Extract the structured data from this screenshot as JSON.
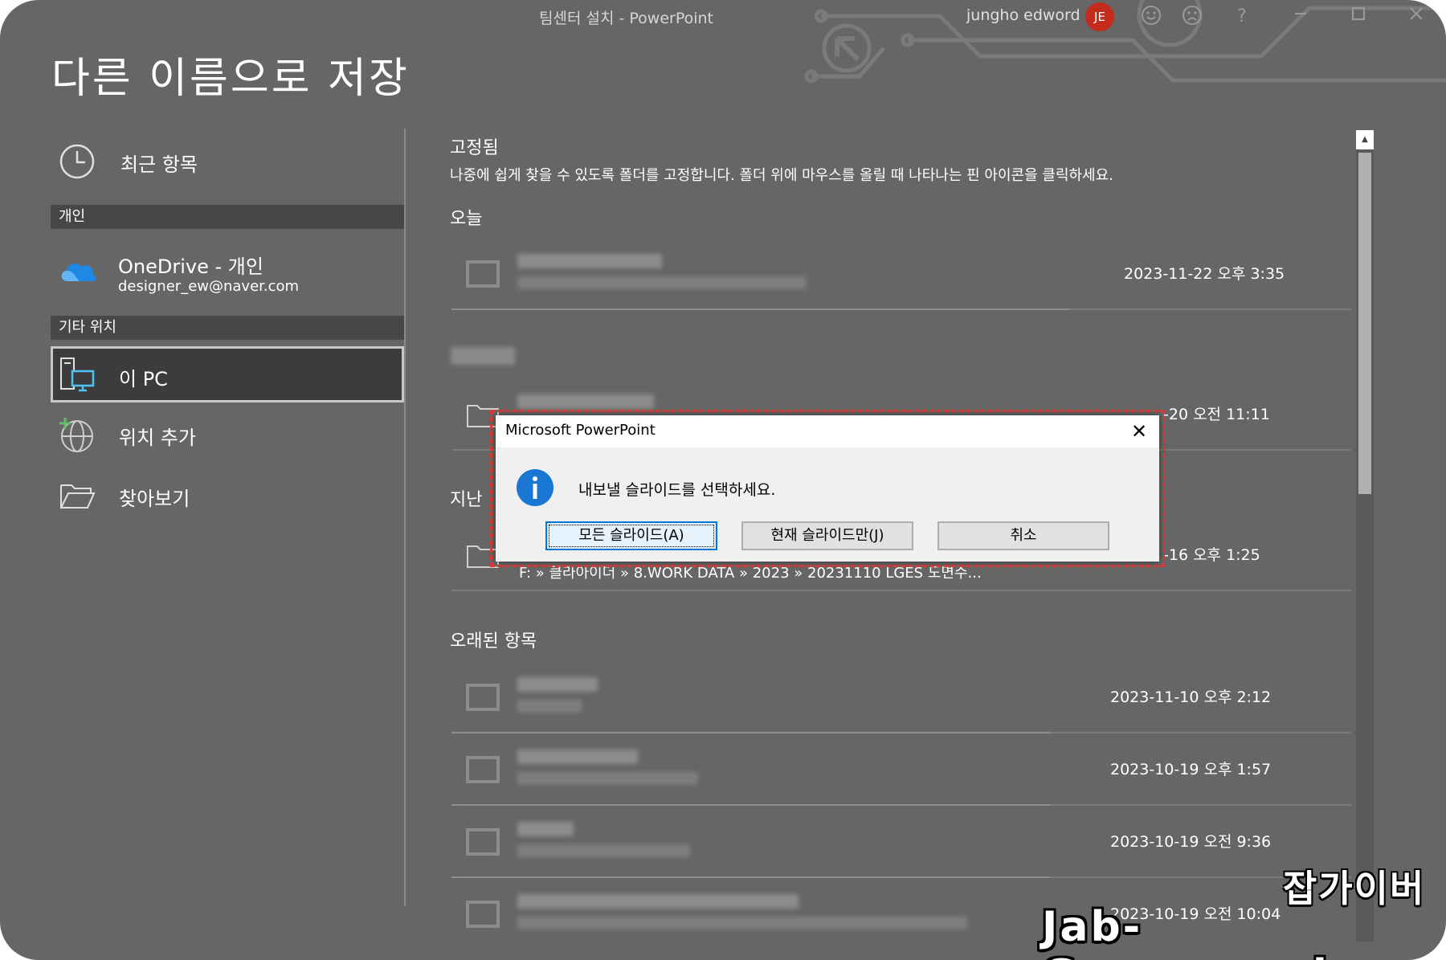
{
  "window": {
    "doc_title": "팀센터 설치  -  PowerPoint",
    "user_name": "jungho edword",
    "avatar_initials": "JE",
    "icons": [
      "smile-icon",
      "frown-icon",
      "help-icon",
      "minimize-icon",
      "maximize-icon",
      "close-icon"
    ],
    "help_glyph": "?"
  },
  "page_title": "다른 이름으로 저장",
  "nav": {
    "recent_label": "최근 항목",
    "personal_header": "개인",
    "onedrive_title": "OneDrive - 개인",
    "onedrive_email": "designer_ew@naver.com",
    "other_header": "기타 위치",
    "this_pc_label": "이 PC",
    "add_place_label": "위치 추가",
    "browse_label": "찾아보기"
  },
  "main": {
    "pinned_label": "고정됨",
    "pinned_hint": "나중에 쉽게 찾을 수 있도록 폴더를 고정합니다. 폴더 위에 마우스를 올릴 때 나타나는 핀 아이콘을 클릭하세요.",
    "today_label": "오늘",
    "last_label": "지난",
    "older_label": "오래된 항목",
    "rows": [
      {
        "date": "2023-11-22 오후 3:35"
      },
      {
        "date": "-20 오전 11:11"
      },
      {
        "date": "-16 오후 1:25",
        "path": "F: » 클라아이더 » 8.WORK DATA » 2023 » 20231110 LGES 도면수..."
      },
      {
        "date": "2023-11-10 오후 2:12"
      },
      {
        "date": "2023-10-19 오후 1:57"
      },
      {
        "date": "2023-10-19 오전 9:36"
      },
      {
        "date": "2023-10-19 오전 10:04"
      }
    ]
  },
  "dialog": {
    "title": "Microsoft PowerPoint",
    "close_glyph": "✕",
    "message": "내보낼 슬라이드를 선택하세요.",
    "btn_all": "모든 슬라이드(A)",
    "btn_current": "현재 슬라이드만(J)",
    "btn_cancel": "취소",
    "highlight_color": "#e53935"
  },
  "watermark": {
    "korean": "잡가이버",
    "domain": "Jab-Guyver.co.kr"
  }
}
